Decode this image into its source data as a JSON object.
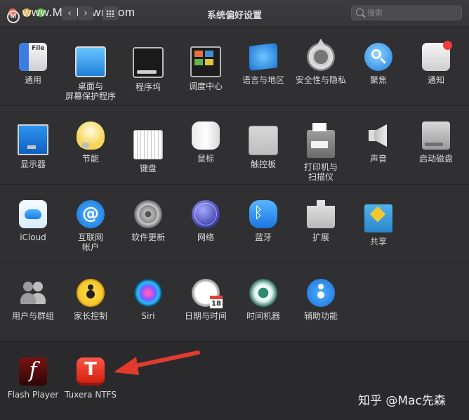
{
  "window": {
    "title": "系统偏好设置",
    "watermark": "www.MacDown.com"
  },
  "toolbar": {
    "back_label": "‹",
    "forward_label": "›",
    "search_placeholder": "搜索"
  },
  "rows": [
    [
      {
        "label": "通用",
        "icon": "general-icon"
      },
      {
        "label": "桌面与\n屏幕保护程序",
        "icon": "desktop-icon"
      },
      {
        "label": "程序坞",
        "icon": "dock-icon"
      },
      {
        "label": "调度中心",
        "icon": "mission-control-icon"
      },
      {
        "label": "语言与地区",
        "icon": "language-region-icon"
      },
      {
        "label": "安全性与隐私",
        "icon": "security-icon"
      },
      {
        "label": "聚焦",
        "icon": "spotlight-icon"
      },
      {
        "label": "通知",
        "icon": "notifications-icon"
      }
    ],
    [
      {
        "label": "显示器",
        "icon": "display-icon"
      },
      {
        "label": "节能",
        "icon": "energy-saver-icon"
      },
      {
        "label": "键盘",
        "icon": "keyboard-icon"
      },
      {
        "label": "鼠标",
        "icon": "mouse-icon"
      },
      {
        "label": "触控板",
        "icon": "trackpad-icon"
      },
      {
        "label": "打印机与\n扫描仪",
        "icon": "printer-icon"
      },
      {
        "label": "声音",
        "icon": "sound-icon"
      },
      {
        "label": "启动磁盘",
        "icon": "startup-disk-icon"
      }
    ],
    [
      {
        "label": "iCloud",
        "icon": "icloud-icon"
      },
      {
        "label": "互联网\n帐户",
        "icon": "internet-accounts-icon"
      },
      {
        "label": "软件更新",
        "icon": "software-update-icon"
      },
      {
        "label": "网络",
        "icon": "network-icon"
      },
      {
        "label": "蓝牙",
        "icon": "bluetooth-icon"
      },
      {
        "label": "扩展",
        "icon": "extensions-icon"
      },
      {
        "label": "共享",
        "icon": "sharing-icon"
      }
    ],
    [
      {
        "label": "用户与群组",
        "icon": "users-groups-icon"
      },
      {
        "label": "家长控制",
        "icon": "parental-controls-icon"
      },
      {
        "label": "Siri",
        "icon": "siri-icon"
      },
      {
        "label": "日期与时间",
        "icon": "date-time-icon"
      },
      {
        "label": "时间机器",
        "icon": "time-machine-icon"
      },
      {
        "label": "辅助功能",
        "icon": "accessibility-icon"
      }
    ],
    [
      {
        "label": "Flash Player",
        "icon": "flash-player-icon"
      },
      {
        "label": "Tuxera NTFS",
        "icon": "tuxera-ntfs-icon"
      }
    ]
  ],
  "footer_watermark": "知乎 @Mac先森",
  "colors": {
    "arrow": "#e23b2e",
    "background": "#303032"
  }
}
